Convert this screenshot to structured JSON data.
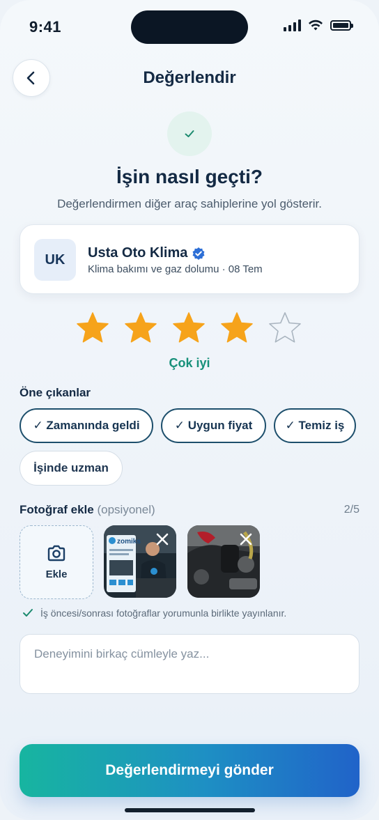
{
  "status_bar": {
    "time": "9:41"
  },
  "header": {
    "title": "Değerlendir"
  },
  "intro": {
    "question": "İşin nasıl geçti?",
    "subtitle": "Değerlendirmen diğer araç sahiplerine yol gösterir."
  },
  "provider": {
    "initials": "UK",
    "name": "Usta Oto Klima",
    "meta": "Klima bakımı ve gaz dolumu · 08 Tem",
    "verified": true
  },
  "rating": {
    "value": 4,
    "max": 5,
    "label": "Çok iyi",
    "star_color": "#f6a31b"
  },
  "highlights": {
    "title": "Öne çıkanlar",
    "chips": [
      {
        "label": "✓ Zamanında geldi",
        "selected": true
      },
      {
        "label": "✓ Uygun fiyat",
        "selected": true
      },
      {
        "label": "✓ Temiz iş",
        "selected": true
      },
      {
        "label": "İşinde uzman",
        "selected": false
      }
    ]
  },
  "photos": {
    "title": "Fotoğraf ekle",
    "optional": "(opsiyonel)",
    "count": "2/5",
    "add_label": "Ekle",
    "thumb1_logo_text": "zomiks",
    "hint": "İş öncesi/sonrası fotoğraflar yorumunla birlikte yayınlanır."
  },
  "comment": {
    "placeholder": "Deneyimini birkaç cümleyle yaz..."
  },
  "submit": {
    "label": "Değerlendirmeyi gönder"
  },
  "colors": {
    "accent": "#17907a",
    "brand_dark": "#142a44",
    "gradient_start": "#17b5a0",
    "gradient_end": "#2063c9"
  }
}
